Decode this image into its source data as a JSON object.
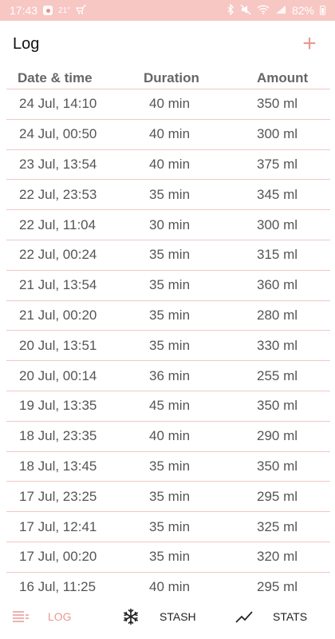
{
  "status_bar": {
    "time": "17:43",
    "temperature": "21°",
    "battery": "82%"
  },
  "app_bar": {
    "title": "Log",
    "add_label": "+"
  },
  "table": {
    "headers": [
      "Date & time",
      "Duration",
      "Amount"
    ],
    "rows": [
      [
        "24 Jul, 14:10",
        "40 min",
        "350 ml"
      ],
      [
        "24 Jul, 00:50",
        "40 min",
        "300 ml"
      ],
      [
        "23 Jul, 13:54",
        "40 min",
        "375 ml"
      ],
      [
        "22 Jul, 23:53",
        "35 min",
        "345 ml"
      ],
      [
        "22 Jul, 11:04",
        "30 min",
        "300 ml"
      ],
      [
        "22 Jul, 00:24",
        "35 min",
        "315 ml"
      ],
      [
        "21 Jul, 13:54",
        "35 min",
        "360 ml"
      ],
      [
        "21 Jul, 00:20",
        "35 min",
        "280 ml"
      ],
      [
        "20 Jul, 13:51",
        "35 min",
        "330 ml"
      ],
      [
        "20 Jul, 00:14",
        "36 min",
        "255 ml"
      ],
      [
        "19 Jul, 13:35",
        "45 min",
        "350 ml"
      ],
      [
        "18 Jul, 23:35",
        "40 min",
        "290 ml"
      ],
      [
        "18 Jul, 13:45",
        "35 min",
        "350 ml"
      ],
      [
        "17 Jul, 23:25",
        "35 min",
        "295 ml"
      ],
      [
        "17 Jul, 12:41",
        "35 min",
        "325 ml"
      ],
      [
        "17 Jul, 00:20",
        "35 min",
        "320 ml"
      ],
      [
        "16 Jul, 11:25",
        "40 min",
        "295 ml"
      ]
    ]
  },
  "bottom_nav": {
    "items": [
      {
        "label": "LOG",
        "icon": "list-icon",
        "active": true
      },
      {
        "label": "STASH",
        "icon": "snowflake-icon",
        "active": false
      },
      {
        "label": "STATS",
        "icon": "trend-line-icon",
        "active": false
      }
    ]
  },
  "colors": {
    "accent": "#e79993",
    "status_bar": "#f7c7c4",
    "divider": "#efc9c5"
  }
}
